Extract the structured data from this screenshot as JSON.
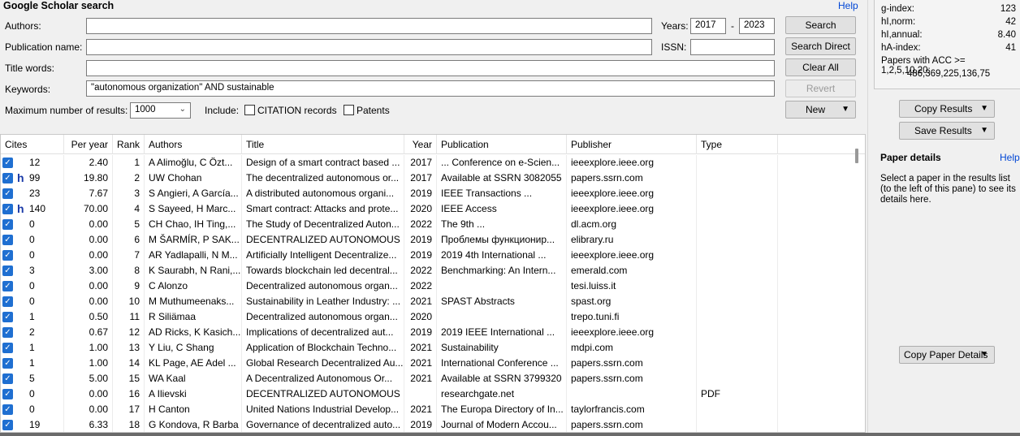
{
  "search": {
    "title": "Google Scholar search",
    "help": "Help",
    "authors_label": "Authors:",
    "authors_value": "",
    "pubname_label": "Publication name:",
    "pubname_value": "",
    "titlewords_label": "Title words:",
    "titlewords_value": "",
    "keywords_label": "Keywords:",
    "keywords_value": "\"autonomous organization\"  AND sustainable",
    "years_label": "Years:",
    "year_from": "2017",
    "year_sep": "-",
    "year_to": "2023",
    "issn_label": "ISSN:",
    "issn_value": "",
    "max_label": "Maximum number of results:",
    "max_value": "1000",
    "include_label": "Include:",
    "citation_label": "CITATION records",
    "patents_label": "Patents",
    "buttons": {
      "search": "Search",
      "search_direct": "Search Direct",
      "clear_all": "Clear All",
      "revert": "Revert",
      "new": "New"
    }
  },
  "columns": [
    "Cites",
    "Per year",
    "Rank",
    "Authors",
    "Title",
    "Year",
    "Publication",
    "Publisher",
    "Type"
  ],
  "rows": [
    {
      "cites": "12",
      "h": "",
      "per_year": "2.40",
      "rank": "1",
      "authors": "A Alimoğlu, C Özt...",
      "title": "Design of a smart contract based ...",
      "year": "2017",
      "publication": "... Conference on e-Scien...",
      "publisher": "ieeexplore.ieee.org",
      "type": ""
    },
    {
      "cites": "99",
      "h": "h",
      "per_year": "19.80",
      "rank": "2",
      "authors": "UW Chohan",
      "title": "The decentralized autonomous or...",
      "year": "2017",
      "publication": "Available at SSRN 3082055",
      "publisher": "papers.ssrn.com",
      "type": ""
    },
    {
      "cites": "23",
      "h": "",
      "per_year": "7.67",
      "rank": "3",
      "authors": "S Angieri, A García...",
      "title": "A distributed autonomous organi...",
      "year": "2019",
      "publication": "IEEE Transactions ...",
      "publisher": "ieeexplore.ieee.org",
      "type": ""
    },
    {
      "cites": "140",
      "h": "h",
      "per_year": "70.00",
      "rank": "4",
      "authors": "S Sayeed, H Marc...",
      "title": "Smart contract: Attacks and prote...",
      "year": "2020",
      "publication": "IEEE Access",
      "publisher": "ieeexplore.ieee.org",
      "type": ""
    },
    {
      "cites": "0",
      "h": "",
      "per_year": "0.00",
      "rank": "5",
      "authors": "CH Chao, IH Ting,...",
      "title": "The Study of Decentralized Auton...",
      "year": "2022",
      "publication": "The 9th ...",
      "publisher": "dl.acm.org",
      "type": ""
    },
    {
      "cites": "0",
      "h": "",
      "per_year": "0.00",
      "rank": "6",
      "authors": "M ŠARMÍR, P SAK...",
      "title": "DECENTRALIZED AUTONOMOUS ...",
      "year": "2019",
      "publication": "Проблемы функционир...",
      "publisher": "elibrary.ru",
      "type": ""
    },
    {
      "cites": "0",
      "h": "",
      "per_year": "0.00",
      "rank": "7",
      "authors": "AR Yadlapalli, N M...",
      "title": "Artificially Intelligent Decentralize...",
      "year": "2019",
      "publication": "2019 4th International ...",
      "publisher": "ieeexplore.ieee.org",
      "type": ""
    },
    {
      "cites": "3",
      "h": "",
      "per_year": "3.00",
      "rank": "8",
      "authors": "K Saurabh, N Rani,...",
      "title": "Towards blockchain led decentral...",
      "year": "2022",
      "publication": "Benchmarking: An Intern...",
      "publisher": "emerald.com",
      "type": ""
    },
    {
      "cites": "0",
      "h": "",
      "per_year": "0.00",
      "rank": "9",
      "authors": "C Alonzo",
      "title": "Decentralized autonomous organ...",
      "year": "2022",
      "publication": "",
      "publisher": "tesi.luiss.it",
      "type": ""
    },
    {
      "cites": "0",
      "h": "",
      "per_year": "0.00",
      "rank": "10",
      "authors": "M Muthumeenaks...",
      "title": "Sustainability in Leather Industry: ...",
      "year": "2021",
      "publication": "SPAST Abstracts",
      "publisher": "spast.org",
      "type": ""
    },
    {
      "cites": "1",
      "h": "",
      "per_year": "0.50",
      "rank": "11",
      "authors": "R Siliämaa",
      "title": "Decentralized autonomous organ...",
      "year": "2020",
      "publication": "",
      "publisher": "trepo.tuni.fi",
      "type": ""
    },
    {
      "cites": "2",
      "h": "",
      "per_year": "0.67",
      "rank": "12",
      "authors": "AD Ricks, K Kasich...",
      "title": "Implications of decentralized aut...",
      "year": "2019",
      "publication": "2019 IEEE International ...",
      "publisher": "ieeexplore.ieee.org",
      "type": ""
    },
    {
      "cites": "1",
      "h": "",
      "per_year": "1.00",
      "rank": "13",
      "authors": "Y Liu, C Shang",
      "title": "Application of Blockchain Techno...",
      "year": "2021",
      "publication": "Sustainability",
      "publisher": "mdpi.com",
      "type": ""
    },
    {
      "cites": "1",
      "h": "",
      "per_year": "1.00",
      "rank": "14",
      "authors": "KL Page, AE Adel ...",
      "title": "Global Research Decentralized Au...",
      "year": "2021",
      "publication": "International Conference ...",
      "publisher": "papers.ssrn.com",
      "type": ""
    },
    {
      "cites": "5",
      "h": "",
      "per_year": "5.00",
      "rank": "15",
      "authors": "WA Kaal",
      "title": "A Decentralized Autonomous Or...",
      "year": "2021",
      "publication": "Available at SSRN 3799320",
      "publisher": "papers.ssrn.com",
      "type": ""
    },
    {
      "cites": "0",
      "h": "",
      "per_year": "0.00",
      "rank": "16",
      "authors": "A Ilievski",
      "title": "DECENTRALIZED AUTONOMOUS ...",
      "year": "",
      "publication": "researchgate.net",
      "publisher": "",
      "type": "PDF"
    },
    {
      "cites": "0",
      "h": "",
      "per_year": "0.00",
      "rank": "17",
      "authors": "H Canton",
      "title": "United Nations Industrial Develop...",
      "year": "2021",
      "publication": "The Europa Directory of In...",
      "publisher": "taylorfrancis.com",
      "type": ""
    },
    {
      "cites": "19",
      "h": "",
      "per_year": "6.33",
      "rank": "18",
      "authors": "G Kondova, R Barba",
      "title": "Governance of decentralized auto...",
      "year": "2019",
      "publication": "Journal of Modern Accou...",
      "publisher": "papers.ssrn.com",
      "type": ""
    }
  ],
  "stats": [
    {
      "label": "g-index:",
      "value": "123"
    },
    {
      "label": "hI,norm:",
      "value": "42"
    },
    {
      "label": "hI,annual:",
      "value": "8.40"
    },
    {
      "label": "hA-index:",
      "value": "41"
    }
  ],
  "acc_label": "Papers with ACC >= 1,2,5,10,20:",
  "acc_values": "486,369,225,136,75",
  "right": {
    "copy_results": "Copy Results",
    "save_results": "Save Results",
    "details_title": "Paper details",
    "details_help": "Help",
    "details_text": "Select a paper in the results list (to the left of this pane) to see its details here.",
    "copy_details": "Copy Paper Details"
  },
  "colors": {
    "checkbox_blue": "#1f6fd1",
    "help_link": "#0046d5",
    "h_mark": "#1a3aa8"
  }
}
